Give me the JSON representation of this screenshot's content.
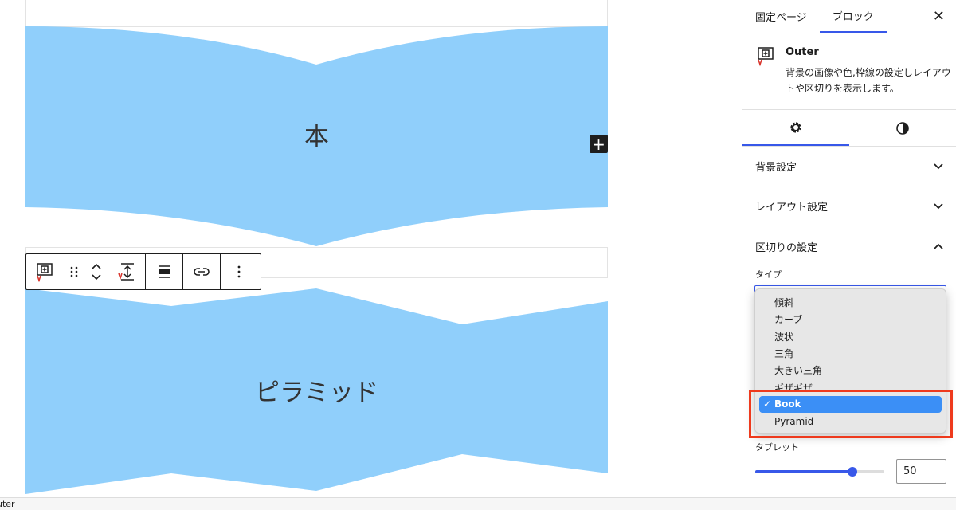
{
  "canvas": {
    "shape_color": "#90cffb",
    "block1_text": "本",
    "block2_text": "ピラミッド",
    "inserter_label": "+"
  },
  "toolbar": {
    "icons": [
      "outer-block-icon",
      "drag-handle-icon",
      "move-up-icon",
      "move-down-icon",
      "height-icon",
      "align-icon",
      "link-icon",
      "more-options-icon"
    ]
  },
  "status_bar": {
    "text": "uter"
  },
  "sidebar": {
    "tabs": [
      {
        "label": "固定ページ"
      },
      {
        "label": "ブロック"
      }
    ],
    "close_label": "✕",
    "block": {
      "title": "Outer",
      "description": "背景の画像や色,枠線の設定しレイアウトや区切りを表示します。"
    },
    "panels": {
      "background": "背景設定",
      "layout": "レイアウト設定",
      "divider": "区切りの設定"
    },
    "divider": {
      "type_label": "タイプ",
      "options": [
        "傾斜",
        "カーブ",
        "波状",
        "三角",
        "大きい三角",
        "ギザギザ",
        "Book",
        "Pyramid"
      ],
      "selected": "Book",
      "check": "✓",
      "tablet_label": "タブレット",
      "tablet_value": "50",
      "tablet_slider_fraction": 0.75
    }
  },
  "colors": {
    "accent": "#3858e9",
    "highlight": "#ee3a1d",
    "selection": "#3b8ff6"
  }
}
